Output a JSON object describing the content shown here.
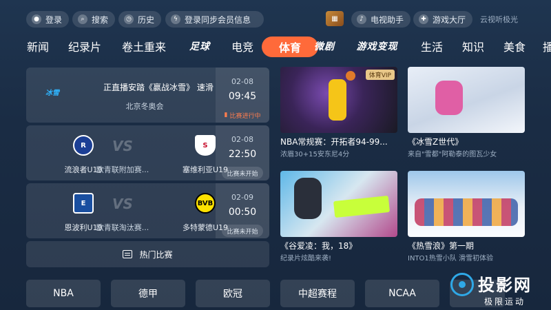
{
  "topbar": {
    "login": "登录",
    "search": "搜索",
    "history": "历史",
    "sync": "登录同步会员信息",
    "tv_assistant": "电视助手",
    "game_hall": "游戏大厅",
    "brand": "云视听极光"
  },
  "nav": {
    "items": [
      "新闻",
      "纪录片",
      "卷土重来",
      "足球",
      "电竞",
      "体育",
      "微剧",
      "游戏变现",
      "生活",
      "知识",
      "美食",
      "播"
    ],
    "active": "体育"
  },
  "matches": [
    {
      "title": "正直播安踏《赢战冰雪》 速滑名将...",
      "subtitle": "北京冬奥会",
      "date": "02-08",
      "time": "09:45",
      "status": "比赛进行中"
    },
    {
      "home": "流浪者U19",
      "league": "欧青联附加赛...",
      "away": "塞维利亚U19",
      "date": "02-08",
      "time": "22:50",
      "status": "比赛未开始"
    },
    {
      "home": "恩波利U19",
      "league": "欧青联淘汰赛...",
      "away": "多特蒙德U19",
      "date": "02-09",
      "time": "00:50",
      "status": "比赛未开始"
    }
  ],
  "hot_matches_label": "热门比赛",
  "videos": [
    {
      "title": "NBA常规赛：开拓者94-99...",
      "sub": "浓眉30+15安东尼4分",
      "badge": "体育VIP"
    },
    {
      "title": "《冰雪Z世代》",
      "sub": "来自\"雪都\"阿勒泰的图瓦少女"
    },
    {
      "title": "《谷爱凌：我，18》",
      "sub": "纪录片炫酷来袭!"
    },
    {
      "title": "《热雪浪》第一期",
      "sub": "INTO1热雪小队 滑雪初体验"
    }
  ],
  "categories": [
    "NBA",
    "德甲",
    "欧冠",
    "中超赛程",
    "NCAA"
  ],
  "watermark": {
    "big": "投影网",
    "small": "极限运动"
  },
  "colors": {
    "accent": "#ff6a3a",
    "live": "#ff7d4e"
  }
}
